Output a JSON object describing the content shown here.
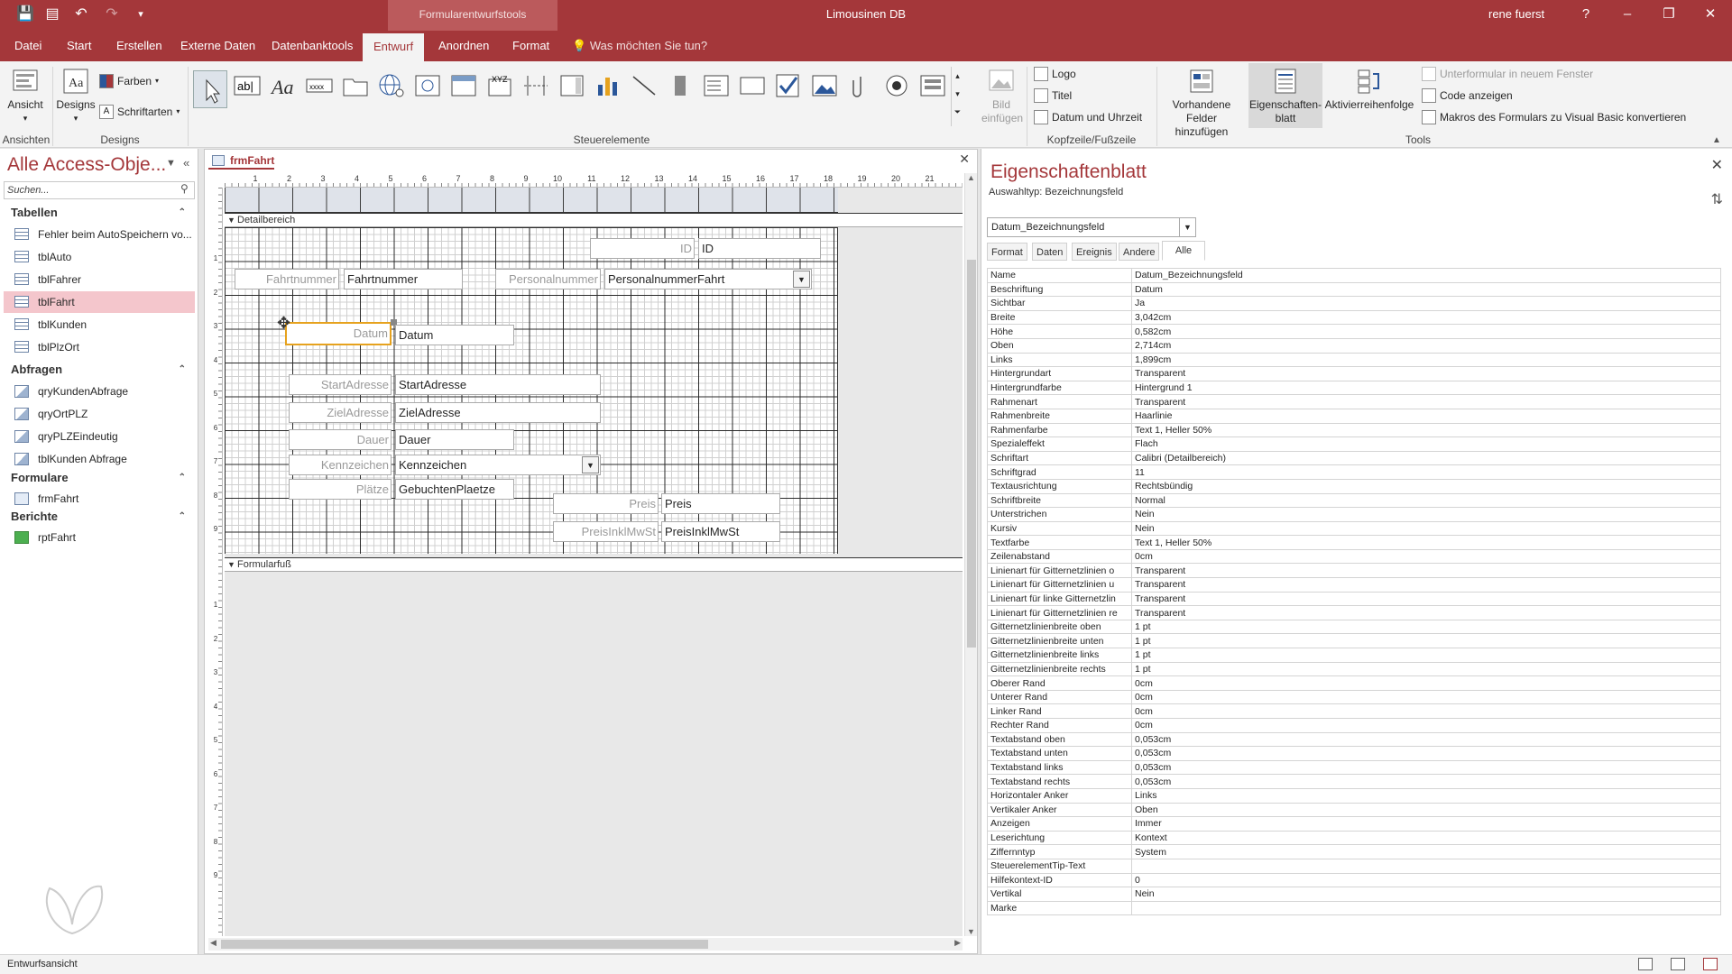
{
  "titlebar": {
    "context_tab": "Formularentwurfstools",
    "app_title": "Limousinen DB",
    "user": "rene fuerst",
    "help": "?",
    "minimize": "–",
    "restore": "❐",
    "close": "✕"
  },
  "ribbon_tabs": [
    "Datei",
    "Start",
    "Erstellen",
    "Externe Daten",
    "Datenbanktools",
    "Entwurf",
    "Anordnen",
    "Format"
  ],
  "tell_me": "Was möchten Sie tun?",
  "ribbon": {
    "ansicht": "Ansicht",
    "designs": "Designs",
    "farben": "Farben",
    "schriftarten": "Schriftarten",
    "group_ansichten": "Ansichten",
    "group_designs": "Designs",
    "group_steuerelemente": "Steuerelemente",
    "bild_einfuegen_1": "Bild",
    "bild_einfuegen_2": "einfügen",
    "logo": "Logo",
    "titel": "Titel",
    "datum_uhrzeit": "Datum und Uhrzeit",
    "group_kopf": "Kopfzeile/Fußzeile",
    "vorhandene_1": "Vorhandene",
    "vorhandene_2": "Felder hinzufügen",
    "eigenschaften_1": "Eigenschaften-",
    "eigenschaften_2": "blatt",
    "aktivierreihenfolge": "Aktivierreihenfolge",
    "unterformular": "Unterformular in neuem Fenster",
    "code_anzeigen": "Code anzeigen",
    "makros": "Makros des Formulars zu Visual Basic konvertieren",
    "group_tools": "Tools"
  },
  "nav": {
    "title": "Alle Access-Obje...",
    "search_placeholder": "Suchen...",
    "sections": [
      {
        "label": "Tabellen",
        "items": [
          "Fehler beim AutoSpeichern vo...",
          "tblAuto",
          "tblFahrer",
          "tblFahrt",
          "tblKunden",
          "tblPlzOrt"
        ]
      },
      {
        "label": "Abfragen",
        "items": [
          "qryKundenAbfrage",
          "qryOrtPLZ",
          "qryPLZEindeutig",
          "tblKunden Abfrage"
        ]
      },
      {
        "label": "Formulare",
        "items": [
          "frmFahrt"
        ]
      },
      {
        "label": "Berichte",
        "items": [
          "rptFahrt"
        ]
      }
    ]
  },
  "document": {
    "tab": "frmFahrt",
    "detail_section": "Detailbereich",
    "footer_section": "Formularfuß",
    "ruler_h": [
      "1",
      "2",
      "3",
      "4",
      "5",
      "6",
      "7",
      "8",
      "9",
      "10",
      "11",
      "12",
      "13",
      "14",
      "15",
      "16",
      "17",
      "18",
      "19",
      "20",
      "21"
    ],
    "ruler_v1": [
      "1",
      "2",
      "3",
      "4",
      "5",
      "6",
      "7",
      "8",
      "9"
    ],
    "ruler_v2": [
      "1",
      "2",
      "3",
      "4",
      "5",
      "6",
      "7",
      "8",
      "9"
    ],
    "controls": {
      "id_label": "ID",
      "id_field": "ID",
      "fahrtnummer_label": "Fahrtnummer",
      "fahrtnummer_field": "Fahrtnummer",
      "personalnummer_label": "Personalnummer",
      "personalnummer_field": "PersonalnummerFahrt",
      "datum_label": "Datum",
      "datum_field": "Datum",
      "startadresse_label": "StartAdresse",
      "startadresse_field": "StartAdresse",
      "zieladresse_label": "ZielAdresse",
      "zieladresse_field": "ZielAdresse",
      "dauer_label": "Dauer",
      "dauer_field": "Dauer",
      "kennzeichen_label": "Kennzeichen",
      "kennzeichen_field": "Kennzeichen",
      "plaetze_label": "Plätze",
      "plaetze_field": "GebuchtenPlaetze",
      "preis_label": "Preis",
      "preis_field": "Preis",
      "preisinkl_label": "PreisInklMwSt",
      "preisinkl_field": "PreisInklMwSt"
    }
  },
  "property_sheet": {
    "title": "Eigenschaftenblatt",
    "selection_type": "Auswahltyp:  Bezeichnungsfeld",
    "selected_object": "Datum_Bezeichnungsfeld",
    "tabs": [
      "Format",
      "Daten",
      "Ereignis",
      "Andere",
      "Alle"
    ],
    "active_tab": "Alle",
    "rows": [
      [
        "Name",
        "Datum_Bezeichnungsfeld"
      ],
      [
        "Beschriftung",
        "Datum"
      ],
      [
        "Sichtbar",
        "Ja"
      ],
      [
        "Breite",
        "3,042cm"
      ],
      [
        "Höhe",
        "0,582cm"
      ],
      [
        "Oben",
        "2,714cm"
      ],
      [
        "Links",
        "1,899cm"
      ],
      [
        "Hintergrundart",
        "Transparent"
      ],
      [
        "Hintergrundfarbe",
        "Hintergrund 1"
      ],
      [
        "Rahmenart",
        "Transparent"
      ],
      [
        "Rahmenbreite",
        "Haarlinie"
      ],
      [
        "Rahmenfarbe",
        "Text 1, Heller 50%"
      ],
      [
        "Spezialeffekt",
        "Flach"
      ],
      [
        "Schriftart",
        "Calibri (Detailbereich)"
      ],
      [
        "Schriftgrad",
        "11"
      ],
      [
        "Textausrichtung",
        "Rechtsbündig"
      ],
      [
        "Schriftbreite",
        "Normal"
      ],
      [
        "Unterstrichen",
        "Nein"
      ],
      [
        "Kursiv",
        "Nein"
      ],
      [
        "Textfarbe",
        "Text 1, Heller 50%"
      ],
      [
        "Zeilenabstand",
        "0cm"
      ],
      [
        "Linienart für Gitternetzlinien o",
        "Transparent"
      ],
      [
        "Linienart für Gitternetzlinien u",
        "Transparent"
      ],
      [
        "Linienart für linke Gitternetzlin",
        "Transparent"
      ],
      [
        "Linienart für Gitternetzlinien re",
        "Transparent"
      ],
      [
        "Gitternetzlinienbreite oben",
        "1 pt"
      ],
      [
        "Gitternetzlinienbreite unten",
        "1 pt"
      ],
      [
        "Gitternetzlinienbreite links",
        "1 pt"
      ],
      [
        "Gitternetzlinienbreite rechts",
        "1 pt"
      ],
      [
        "Oberer Rand",
        "0cm"
      ],
      [
        "Unterer Rand",
        "0cm"
      ],
      [
        "Linker Rand",
        "0cm"
      ],
      [
        "Rechter Rand",
        "0cm"
      ],
      [
        "Textabstand oben",
        "0,053cm"
      ],
      [
        "Textabstand unten",
        "0,053cm"
      ],
      [
        "Textabstand links",
        "0,053cm"
      ],
      [
        "Textabstand rechts",
        "0,053cm"
      ],
      [
        "Horizontaler Anker",
        "Links"
      ],
      [
        "Vertikaler Anker",
        "Oben"
      ],
      [
        "Anzeigen",
        "Immer"
      ],
      [
        "Leserichtung",
        "Kontext"
      ],
      [
        "Ziffernntyp",
        "System"
      ],
      [
        "SteuerelementTip-Text",
        ""
      ],
      [
        "Hilfekontext-ID",
        "0"
      ],
      [
        "Vertikal",
        "Nein"
      ],
      [
        "Marke",
        ""
      ]
    ]
  },
  "status": {
    "mode": "Entwurfsansicht"
  },
  "colors": {
    "accent": "#a4373a",
    "selection": "#e6a21e",
    "nav_selected": "#f4c6cc"
  }
}
